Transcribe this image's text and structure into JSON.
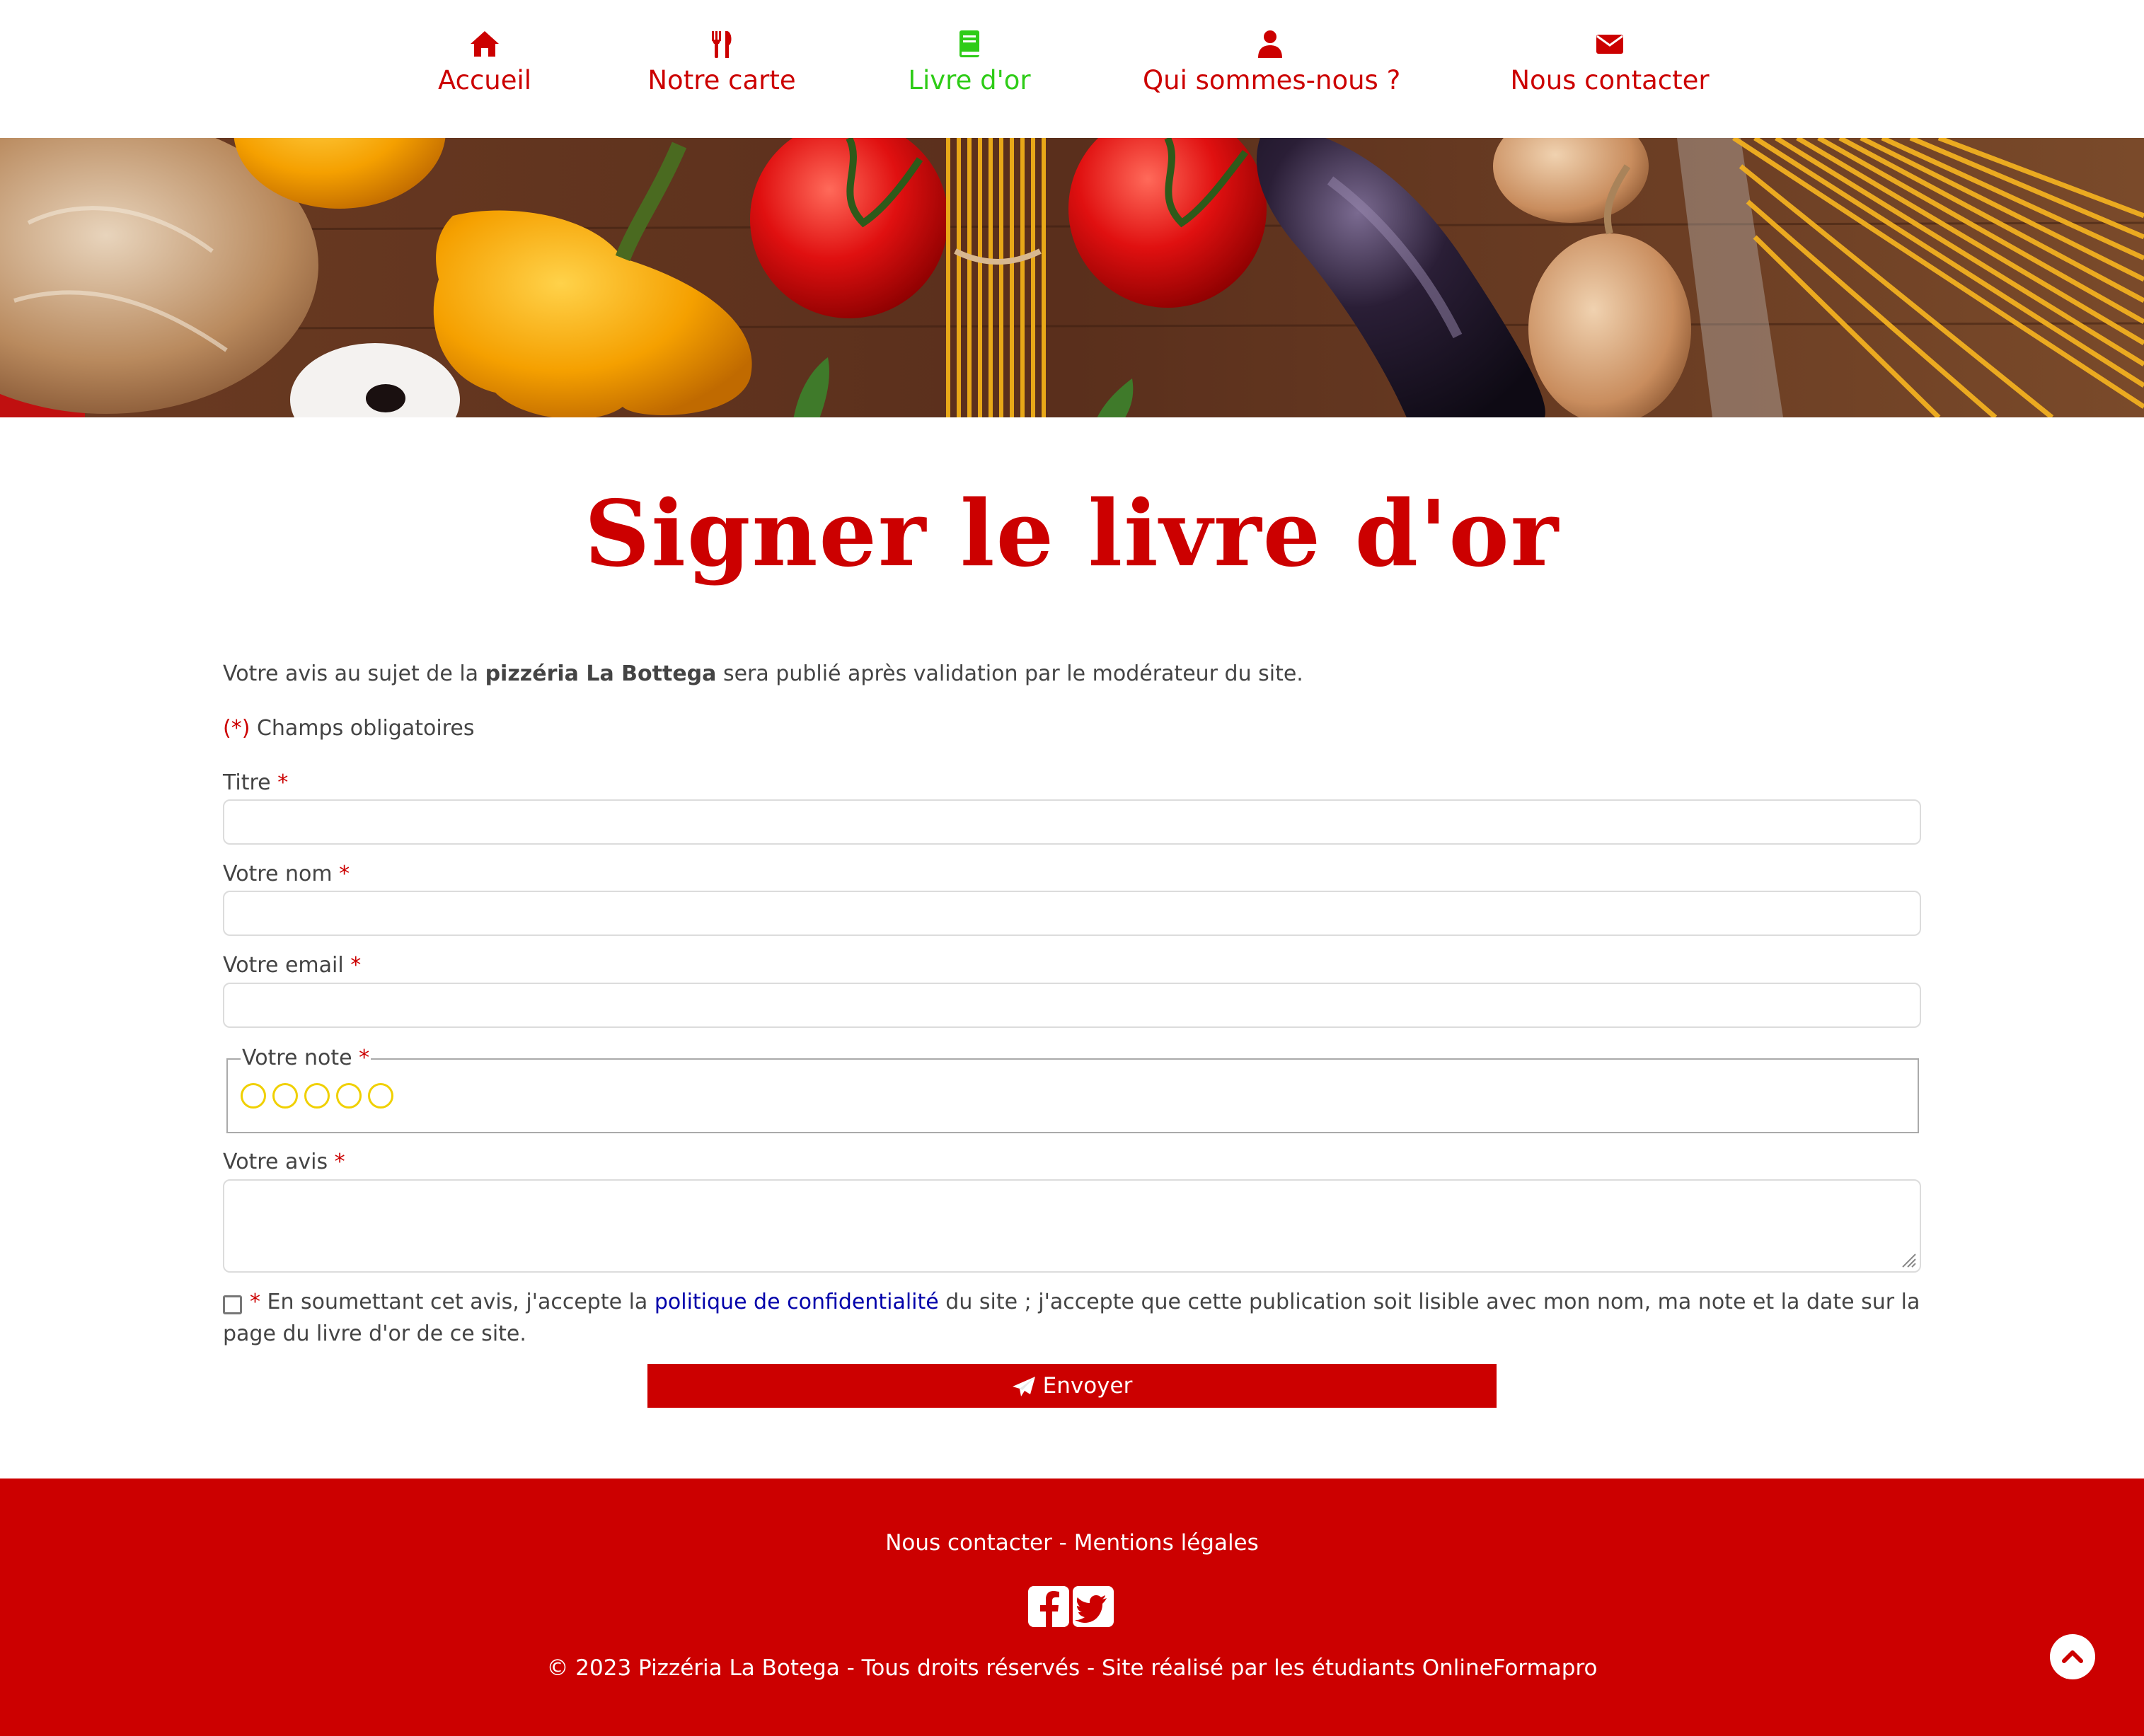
{
  "nav": {
    "items": [
      {
        "label": "Accueil",
        "icon": "home-icon"
      },
      {
        "label": "Notre carte",
        "icon": "fork-knife-icon"
      },
      {
        "label": "Livre d'or",
        "icon": "book-icon",
        "active": true
      },
      {
        "label": "Qui sommes-nous ?",
        "icon": "user-icon"
      },
      {
        "label": "Nous contacter",
        "icon": "envelope-icon"
      }
    ]
  },
  "colors": {
    "brand_red": "#cc0000",
    "active_green": "#2ecc17",
    "star_yellow": "#f0d000",
    "link_blue": "#0000aa"
  },
  "page": {
    "title": "Signer le livre d'or",
    "intro_before": "Votre avis au sujet de la ",
    "intro_bold": "pizzéria La Bottega",
    "intro_after": " sera publié après validation par le modérateur du site.",
    "required_marker": "(*)",
    "required_text": " Champs obligatoires"
  },
  "form": {
    "asterisk": "*",
    "title_label": "Titre",
    "name_label": "Votre nom",
    "email_label": "Votre email",
    "rating_label": "Votre note",
    "rating_value": 0,
    "rating_max": 5,
    "review_label": "Votre avis",
    "title_value": "",
    "name_value": "",
    "email_value": "",
    "review_value": "",
    "consent_before": "En soumettant cet avis, j'accepte la ",
    "consent_link": "politique de confidentialité",
    "consent_after": " du site ; j'accepte que cette publication soit lisible avec mon nom, ma note et la date sur la page du livre d'or de ce site.",
    "consent_checked": false,
    "submit_label": "Envoyer"
  },
  "footer": {
    "contact_link": "Nous contacter",
    "separator": " - ",
    "legal_link": "Mentions légales",
    "copyright": "© 2023 Pizzéria La Botega - Tous droits réservés - Site réalisé par les étudiants OnlineFormapro",
    "social": [
      "facebook-icon",
      "twitter-icon"
    ]
  }
}
